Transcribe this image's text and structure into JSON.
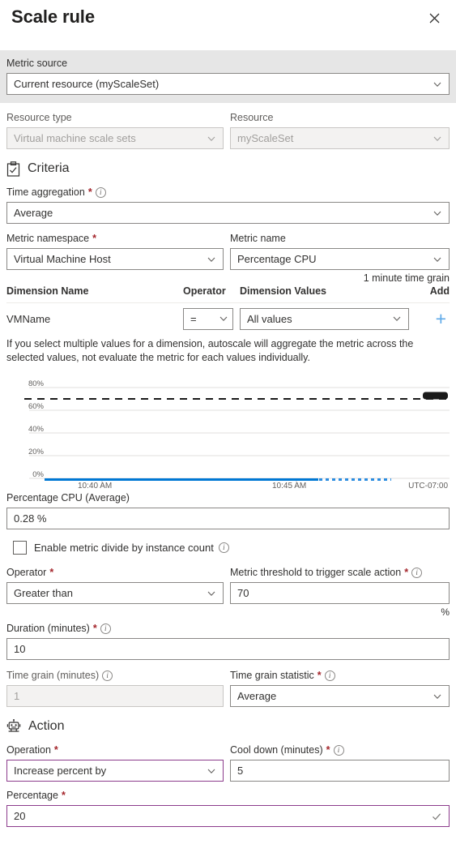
{
  "header": {
    "title": "Scale rule",
    "close_label": "Close"
  },
  "metric_source": {
    "label": "Metric source",
    "value": "Current resource (myScaleSet)"
  },
  "resource": {
    "type_label": "Resource type",
    "type_value": "Virtual machine scale sets",
    "resource_label": "Resource",
    "resource_value": "myScaleSet"
  },
  "criteria": {
    "section_title": "Criteria",
    "section_icon": "clipboard-check-icon",
    "time_aggregation_label": "Time aggregation",
    "time_aggregation_value": "Average",
    "metric_namespace_label": "Metric namespace",
    "metric_namespace_value": "Virtual Machine Host",
    "metric_name_label": "Metric name",
    "metric_name_value": "Percentage CPU",
    "time_grain_note": "1 minute time grain",
    "table": {
      "columns": [
        "Dimension Name",
        "Operator",
        "Dimension Values",
        "Add"
      ],
      "rows": [
        {
          "name": "VMName",
          "operator": "=",
          "values": "All values",
          "add": "+"
        }
      ]
    },
    "hint": "If you select multiple values for a dimension, autoscale will aggregate the metric across the selected values, not evaluate the metric for each values individually.",
    "metric_readout_label": "Percentage CPU (Average)",
    "metric_readout_value": "0.28 %",
    "divide_checkbox_label": "Enable metric divide by instance count",
    "divide_checkbox_checked": false,
    "operator_label": "Operator",
    "operator_value": "Greater than",
    "threshold_label": "Metric threshold to trigger scale action",
    "threshold_value": "70",
    "threshold_suffix": "%",
    "duration_label": "Duration (minutes)",
    "duration_value": "10",
    "time_grain_label": "Time grain (minutes)",
    "time_grain_value": "1",
    "time_grain_stat_label": "Time grain statistic",
    "time_grain_stat_value": "Average"
  },
  "action": {
    "section_title": "Action",
    "section_icon": "robot-icon",
    "operation_label": "Operation",
    "operation_value": "Increase percent by",
    "cooldown_label": "Cool down (minutes)",
    "cooldown_value": "5",
    "percentage_label": "Percentage",
    "percentage_value": "20"
  },
  "colors": {
    "accent_purple": "#8c3c8c",
    "required_red": "#a4262c",
    "series_blue": "#0078d4",
    "add_blue": "#5ea9e8",
    "band_gray": "#e6e6e6"
  },
  "chart_data": {
    "type": "line",
    "title": "",
    "xlabel": "",
    "ylabel": "",
    "ylim": [
      0,
      80
    ],
    "yticks": [
      0,
      20,
      40,
      60,
      80
    ],
    "ytick_labels": [
      "0%",
      "20%",
      "40%",
      "60%",
      "80%"
    ],
    "xtick_labels": [
      "10:40 AM",
      "10:45 AM"
    ],
    "timezone_label": "UTC-07:00",
    "grid": true,
    "legend": "none",
    "threshold": {
      "value": 70,
      "label": "",
      "style": "dashed",
      "color": "#1a1a1a",
      "handle": true
    },
    "series": [
      {
        "name": "Percentage CPU (Average)",
        "color": "#0078d4",
        "style_solid_until": "10:46 AM",
        "style_after": "dotted",
        "values": [
          0.28,
          0.28,
          0.28,
          0.28,
          0.28,
          0.28,
          0.28,
          0.28,
          0.28,
          0.28,
          0.28,
          0.28
        ]
      }
    ]
  }
}
